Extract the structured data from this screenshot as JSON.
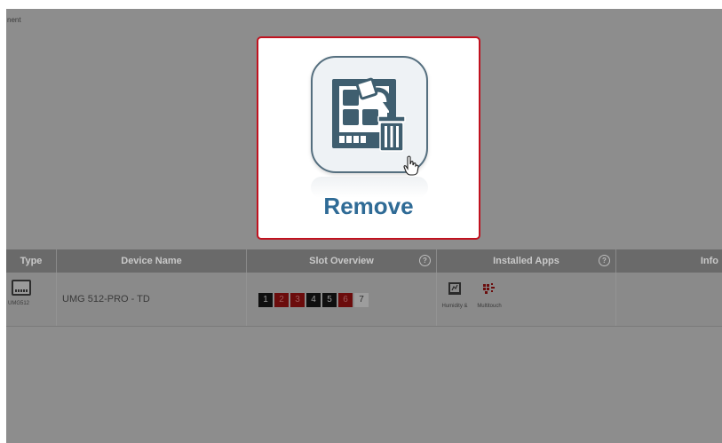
{
  "page": {
    "partial_title": "nent"
  },
  "modal": {
    "action_label": "Remove",
    "icon": "remove-module-icon"
  },
  "table": {
    "columns": [
      {
        "label": "Type",
        "help": false
      },
      {
        "label": "Device Name",
        "help": false
      },
      {
        "label": "Slot Overview",
        "help": true
      },
      {
        "label": "Installed Apps",
        "help": true
      },
      {
        "label": "Info",
        "help": false
      }
    ],
    "help_glyph": "?",
    "rows": [
      {
        "type_label": "UMG512",
        "device_name": "UMG 512-PRO - TD",
        "slots": [
          {
            "number": "1",
            "state": "black"
          },
          {
            "number": "2",
            "state": "red"
          },
          {
            "number": "3",
            "state": "red"
          },
          {
            "number": "4",
            "state": "black"
          },
          {
            "number": "5",
            "state": "black"
          },
          {
            "number": "6",
            "state": "red"
          },
          {
            "number": "7",
            "state": "white"
          }
        ],
        "apps": [
          {
            "label": "Humidity &",
            "icon": "humidity-app-icon"
          },
          {
            "label": "Multitouch",
            "icon": "multitouch-app-icon"
          }
        ]
      }
    ]
  },
  "colors": {
    "accent_red": "#c1121f",
    "remove_blue": "#2f6b96"
  }
}
